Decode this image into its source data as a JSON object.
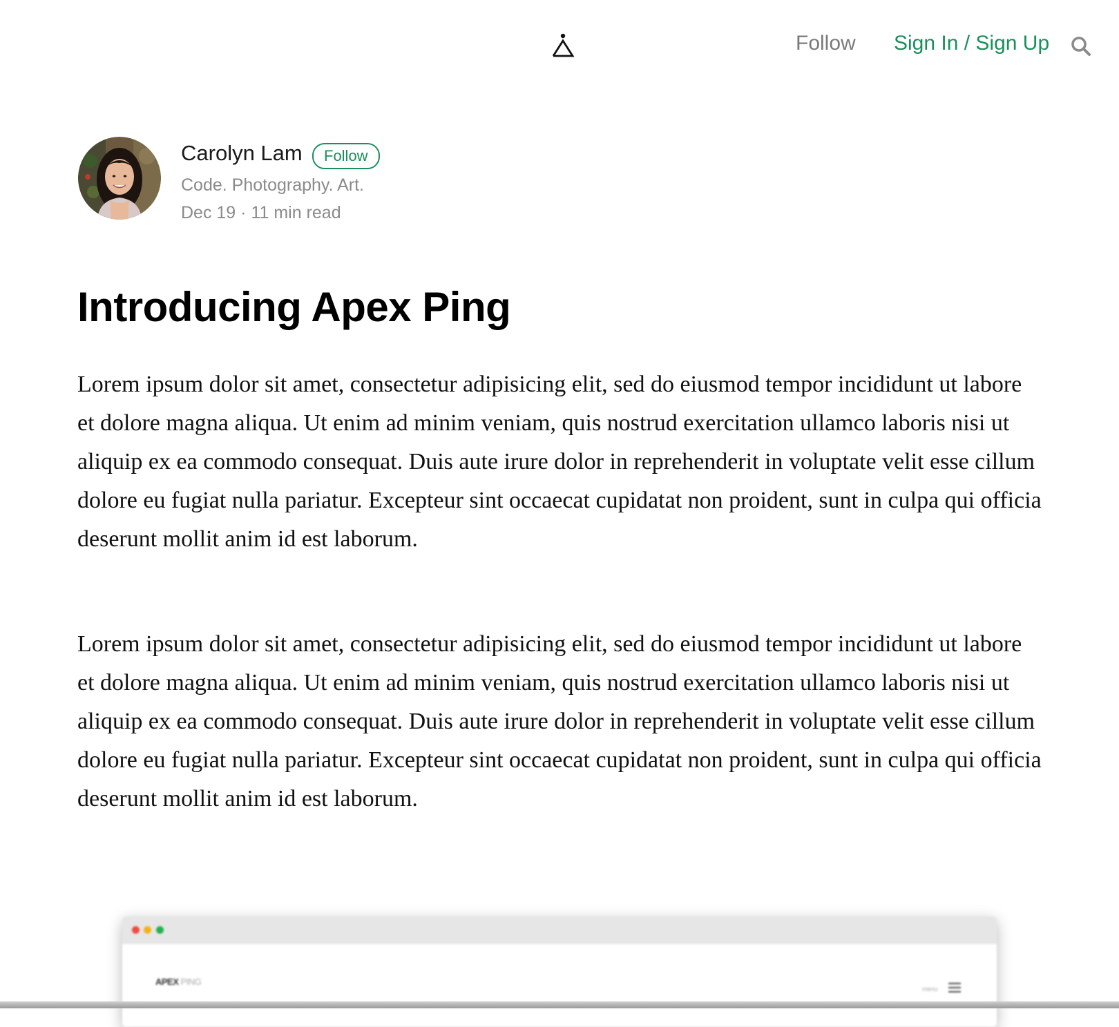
{
  "header": {
    "logo_icon": "apex-triangle-logo",
    "follow_label": "Follow",
    "signin_label": "Sign In / Sign Up",
    "search_icon": "search-icon",
    "accent_color": "#1a8f5b"
  },
  "author": {
    "name": "Carolyn Lam",
    "follow_label": "Follow",
    "bio": "Code. Photography. Art.",
    "meta": "Dec 19 · 11 min read"
  },
  "article": {
    "title": "Introducing Apex Ping",
    "paragraphs": [
      "Lorem ipsum dolor sit amet, consectetur adipisicing elit, sed do eiusmod tempor incididunt ut labore et dolore magna aliqua. Ut enim ad minim veniam, quis nostrud exercitation ullamco laboris nisi ut aliquip ex ea commodo consequat. Duis aute irure dolor in reprehenderit in voluptate velit esse cillum dolore eu fugiat nulla pariatur. Excepteur sint occaecat cupidatat non proident, sunt in culpa qui officia deserunt mollit anim id est laborum.",
      "Lorem ipsum dolor sit amet, consectetur adipisicing elit, sed do eiusmod tempor incididunt ut labore et dolore magna aliqua. Ut enim ad minim veniam, quis nostrud exercitation ullamco laboris nisi ut aliquip ex ea commodo consequat. Duis aute irure dolor in reprehenderit in voluptate velit esse cillum dolore eu fugiat nulla pariatur. Excepteur sint occaecat cupidatat non proident, sunt in culpa qui officia deserunt mollit anim id est laborum."
    ]
  },
  "embed": {
    "brand_bold": "APEX",
    "brand_light": " PING",
    "menu_label": "menu"
  }
}
